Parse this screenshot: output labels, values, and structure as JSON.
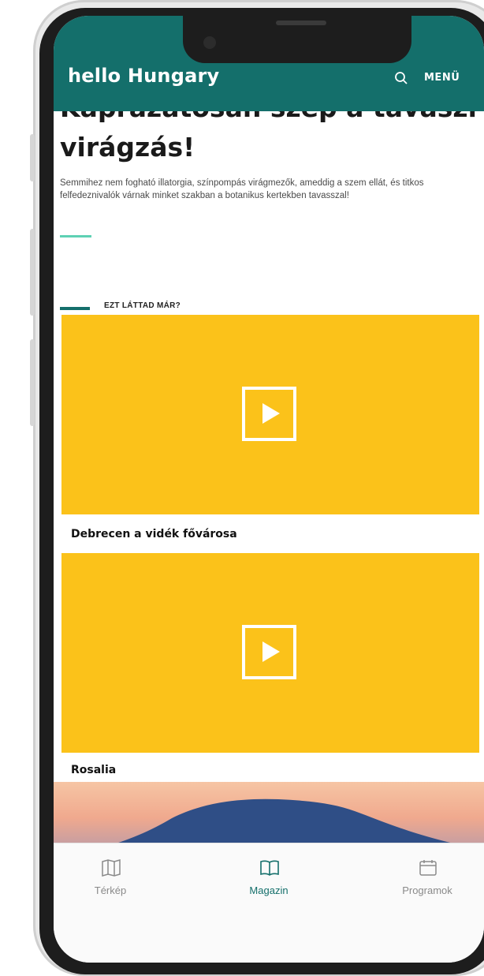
{
  "app": {
    "logo": "hello Hungary",
    "menu_label": "MENÜ"
  },
  "article": {
    "title_partial": "Káprázatosan szép a tavaszi",
    "title": "virágzás!",
    "lead": "Semmihez nem fogható illatorgia, színpompás virágmezők, ameddig a szem ellát, és titkos felfedeznivalók várnak minket szakban a botanikus kertekben tavasszal!"
  },
  "section": {
    "label": "EZT LÁTTAD MÁR?"
  },
  "videos": [
    {
      "title": "Debrecen a vidék fővárosa"
    },
    {
      "title": "Rosalia"
    }
  ],
  "bottom_nav": [
    {
      "label": "Térkép",
      "icon": "map-icon",
      "active": false
    },
    {
      "label": "Magazin",
      "icon": "book-icon",
      "active": true
    },
    {
      "label": "Programok",
      "icon": "calendar-icon",
      "active": false
    }
  ],
  "colors": {
    "header": "#146f6b",
    "accent": "#5ed1b4",
    "video_placeholder": "#fbc21a"
  }
}
